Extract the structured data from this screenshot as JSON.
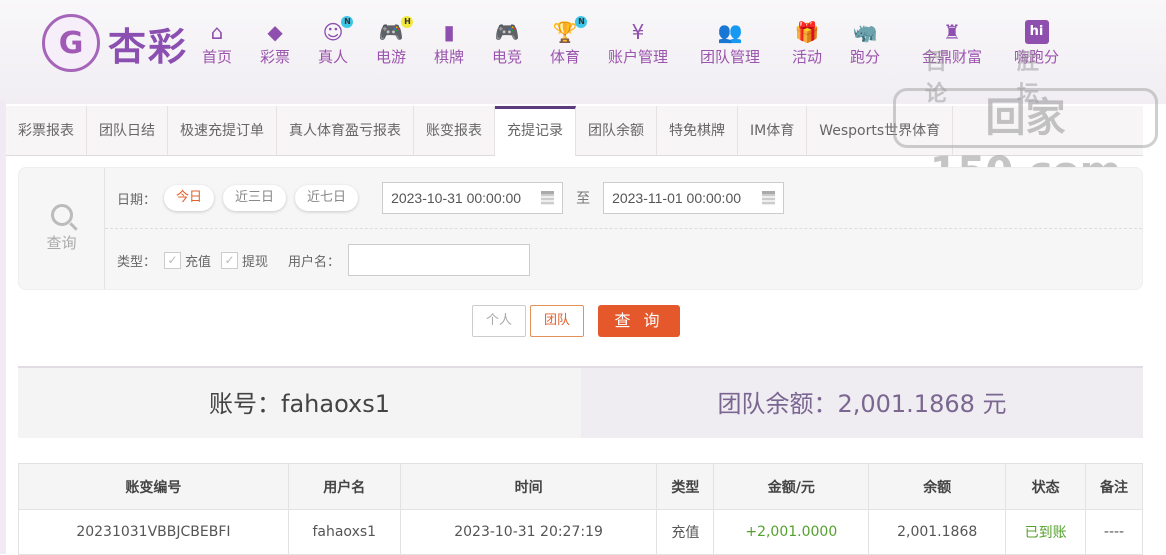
{
  "logo": {
    "text": "杏彩"
  },
  "nav": [
    {
      "label": "首页",
      "icon": "home-icon",
      "glyph": "⌂"
    },
    {
      "label": "彩票",
      "icon": "ticket-icon",
      "glyph": "◆"
    },
    {
      "label": "真人",
      "icon": "live-dealer-icon",
      "glyph": "☺",
      "badge": "N",
      "badge_color": "#3ec6e8"
    },
    {
      "label": "电游",
      "icon": "gamepad-icon",
      "glyph": "🎮",
      "badge": "H",
      "badge_color": "#f3e83c"
    },
    {
      "label": "棋牌",
      "icon": "cards-icon",
      "glyph": "▮"
    },
    {
      "label": "电竞",
      "icon": "gamepad-icon",
      "glyph": "🎮"
    },
    {
      "label": "体育",
      "icon": "trophy-icon",
      "glyph": "🏆",
      "badge": "N",
      "badge_color": "#3ec6e8"
    },
    {
      "label": "账户管理",
      "icon": "yen-coin-icon",
      "glyph": "¥"
    },
    {
      "label": "团队管理",
      "icon": "team-icon",
      "glyph": "👥"
    },
    {
      "label": "活动",
      "icon": "gift-icon",
      "glyph": "🎁"
    },
    {
      "label": "跑分",
      "icon": "rhino-icon",
      "glyph": "🦏"
    },
    {
      "label": "金鼎财富",
      "icon": "cauldron-icon",
      "glyph": "♜"
    },
    {
      "label": "嗨跑分",
      "icon": "hi-app-icon",
      "glyph": "hi"
    }
  ],
  "watermark": {
    "top": "百胜 论坛",
    "main": "回家150.com"
  },
  "tabs": [
    {
      "label": "彩票报表"
    },
    {
      "label": "团队日结"
    },
    {
      "label": "极速充提订单"
    },
    {
      "label": "真人体育盈亏报表"
    },
    {
      "label": "账变报表"
    },
    {
      "label": "充提记录",
      "active": true
    },
    {
      "label": "团队余额"
    },
    {
      "label": "特免棋牌"
    },
    {
      "label": "IM体育"
    },
    {
      "label": "Wesports世界体育"
    }
  ],
  "filter": {
    "side_label": "查询",
    "date_label": "日期：",
    "quick_dates": [
      "今日",
      "近三日",
      "近七日"
    ],
    "start": "2023-10-31 00:00:00",
    "to": "至",
    "end": "2023-11-01 00:00:00",
    "type_label": "类型：",
    "types": [
      {
        "label": "充值",
        "checked": true
      },
      {
        "label": "提现",
        "checked": true
      }
    ],
    "username_label": "用户名：",
    "username_value": ""
  },
  "buttons": {
    "personal": "个人",
    "team": "团队",
    "query": "查 询"
  },
  "summary": {
    "account": "账号：fahaoxs1",
    "balance": "团队余额：2,001.1868 元"
  },
  "table": {
    "headers": [
      "账变编号",
      "用户名",
      "时间",
      "类型",
      "金额/元",
      "余额",
      "状态",
      "备注"
    ],
    "rows": [
      [
        "20231031VBBJCBEBFI",
        "fahaoxs1",
        "2023-10-31 20:27:19",
        "充值",
        "+2,001.0000",
        "2,001.1868",
        "已到账",
        "----"
      ]
    ]
  },
  "colors": {
    "accent": "#e4582b",
    "brand": "#8e4fae",
    "success": "#55a12e"
  }
}
